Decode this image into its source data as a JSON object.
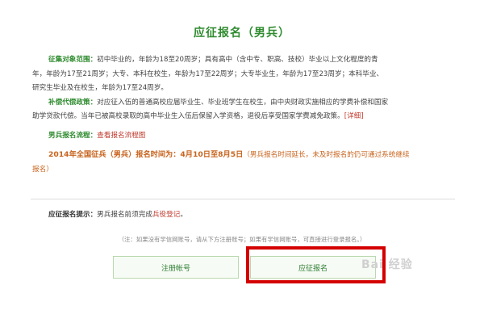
{
  "title": "应征报名（男兵）",
  "recruit_scope": {
    "label": "征集对象范围：",
    "line1": "初中毕业的，年龄为18至20周岁；具有高中（含中专、职高、技校）毕业以上文化程度的青",
    "line2": "年，年龄为17至21周岁；大专、本科在校生，年龄为17至22周岁；大专毕业生，年龄为17至23周岁；本科毕业、",
    "line3": "研究生毕业及在校生，年龄为17至24周岁。"
  },
  "subsidy": {
    "label": "补偿代偿政策：",
    "line1": "对应征入伍的普通高校应届毕业生、毕业班学生在校生，由中央财政实施相应的学费补偿和国家",
    "line2": "助学贷款代偿。当年已被高校录取的高中毕业生入伍后保留入学资格，退役后享受国家学费减免政策。",
    "detail_link": "[详细]"
  },
  "process": {
    "label": "男兵报名流程：",
    "link": "查看报名流程图"
  },
  "schedule": {
    "label": "2014年全国征兵（男兵）报名时间为：",
    "dates": "4月10日至8月5日",
    "note_line1": "（男兵报名时间延长，未及时报名的仍可通过系统继续",
    "note_line2": "报名）"
  },
  "hint": {
    "label": "应征报名提示：",
    "text": "男兵报名前须完成",
    "link": "兵役登记",
    "suffix": "。"
  },
  "note": "（注：如果没有学信网账号，请从下方注册账号；如果有学信网账号，可直接进行登录报名。）",
  "buttons": {
    "register": "注册帐号",
    "apply": "应征报名"
  },
  "watermark": "Bai 经验",
  "colors": {
    "green": "#2e8b2e",
    "orange": "#c8641e",
    "link_red": "#c0392b",
    "highlight_red": "#d40000"
  }
}
